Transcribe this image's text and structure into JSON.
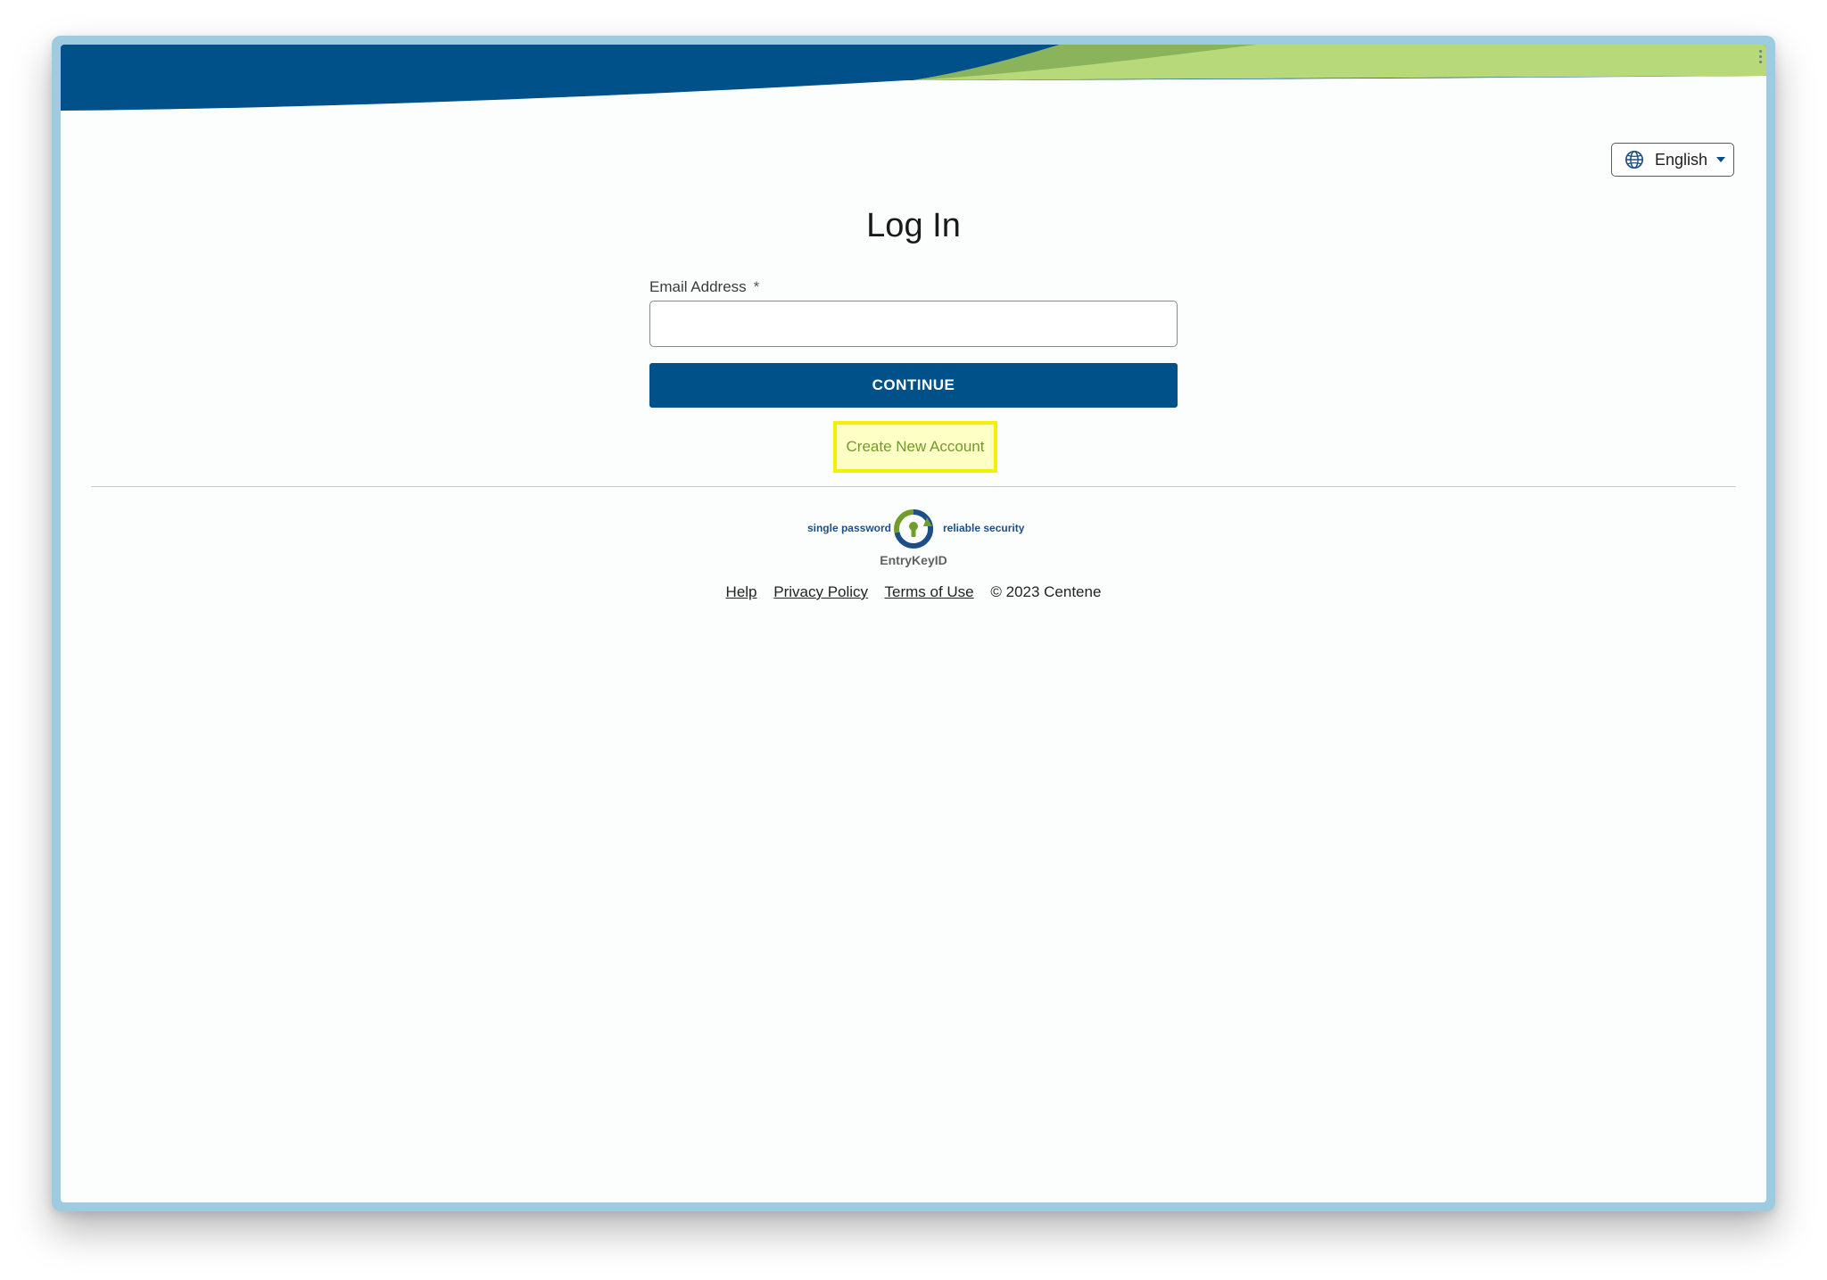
{
  "header": {
    "language": {
      "selected": "English",
      "icon": "globe-icon"
    }
  },
  "login": {
    "title": "Log In",
    "email_label": "Email Address",
    "required_marker": "*",
    "email_value": "",
    "continue_label": "CONTINUE",
    "create_account_label": "Create New Account"
  },
  "brand": {
    "tagline_left": "single password",
    "tagline_right": "reliable security",
    "logo_name": "EntryKeyID",
    "logo_icon": "entrykey-lock-icon"
  },
  "footer": {
    "links": [
      "Help",
      "Privacy Policy",
      "Terms of Use"
    ],
    "copyright": "© 2023 Centene"
  },
  "colors": {
    "primary_blue": "#005089",
    "accent_green": "#b8d97a",
    "mid_green": "#8ab35c",
    "link_green": "#6f9c2a",
    "highlight_yellow": "#f2f200"
  }
}
